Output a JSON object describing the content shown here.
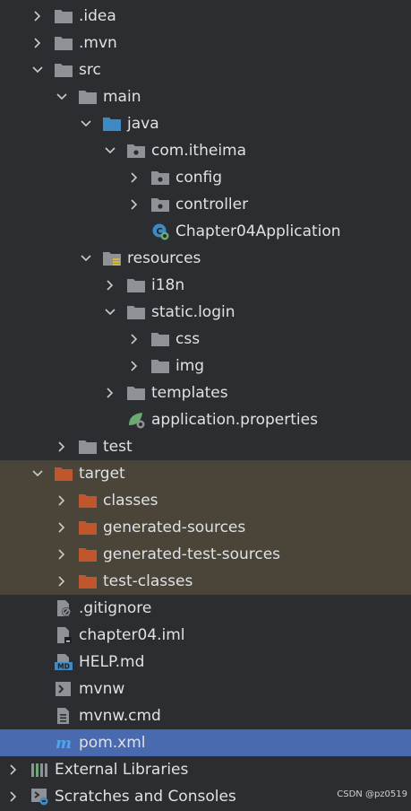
{
  "tree": [
    {
      "label": ".idea",
      "state": "collapsed",
      "icon": "folder-icon",
      "depth": 1
    },
    {
      "label": ".mvn",
      "state": "collapsed",
      "icon": "folder-icon",
      "depth": 1
    },
    {
      "label": "src",
      "state": "expanded",
      "icon": "folder-icon",
      "depth": 1
    },
    {
      "label": "main",
      "state": "expanded",
      "icon": "folder-icon",
      "depth": 2
    },
    {
      "label": "java",
      "state": "expanded",
      "icon": "source-folder-icon",
      "depth": 3
    },
    {
      "label": "com.itheima",
      "state": "expanded",
      "icon": "package-icon",
      "depth": 4
    },
    {
      "label": "config",
      "state": "collapsed",
      "icon": "package-icon",
      "depth": 5
    },
    {
      "label": "controller",
      "state": "collapsed",
      "icon": "package-icon",
      "depth": 5
    },
    {
      "label": "Chapter04Application",
      "state": "leaf",
      "icon": "spring-boot-class-icon",
      "depth": 5
    },
    {
      "label": "resources",
      "state": "expanded",
      "icon": "resources-folder-icon",
      "depth": 3
    },
    {
      "label": "i18n",
      "state": "collapsed",
      "icon": "folder-icon",
      "depth": 4
    },
    {
      "label": "static.login",
      "state": "expanded",
      "icon": "folder-icon",
      "depth": 4
    },
    {
      "label": "css",
      "state": "collapsed",
      "icon": "folder-icon",
      "depth": 5
    },
    {
      "label": "img",
      "state": "collapsed",
      "icon": "folder-icon",
      "depth": 5
    },
    {
      "label": "templates",
      "state": "collapsed",
      "icon": "folder-icon",
      "depth": 4
    },
    {
      "label": "application.properties",
      "state": "leaf",
      "icon": "spring-properties-icon",
      "depth": 4
    },
    {
      "label": "test",
      "state": "collapsed",
      "icon": "folder-icon",
      "depth": 2
    },
    {
      "label": "target",
      "state": "expanded",
      "icon": "excluded-folder-icon",
      "depth": 1,
      "highlight": "target"
    },
    {
      "label": "classes",
      "state": "collapsed",
      "icon": "excluded-folder-icon",
      "depth": 2,
      "highlight": "target"
    },
    {
      "label": "generated-sources",
      "state": "collapsed",
      "icon": "excluded-folder-icon",
      "depth": 2,
      "highlight": "target"
    },
    {
      "label": "generated-test-sources",
      "state": "collapsed",
      "icon": "excluded-folder-icon",
      "depth": 2,
      "highlight": "target"
    },
    {
      "label": "test-classes",
      "state": "collapsed",
      "icon": "excluded-folder-icon",
      "depth": 2,
      "highlight": "target"
    },
    {
      "label": ".gitignore",
      "state": "leaf",
      "icon": "gitignore-file-icon",
      "depth": 1
    },
    {
      "label": "chapter04.iml",
      "state": "leaf",
      "icon": "iml-file-icon",
      "depth": 1
    },
    {
      "label": "HELP.md",
      "state": "leaf",
      "icon": "markdown-file-icon",
      "depth": 1
    },
    {
      "label": "mvnw",
      "state": "leaf",
      "icon": "shell-script-icon",
      "depth": 1
    },
    {
      "label": "mvnw.cmd",
      "state": "leaf",
      "icon": "text-file-icon",
      "depth": 1
    },
    {
      "label": "pom.xml",
      "state": "leaf",
      "icon": "maven-pom-icon",
      "depth": 1,
      "selected": true
    },
    {
      "label": "External Libraries",
      "state": "collapsed",
      "icon": "libraries-icon",
      "depth": 0
    },
    {
      "label": "Scratches and Consoles",
      "state": "collapsed",
      "icon": "scratches-icon",
      "depth": 0
    }
  ],
  "watermark": "CSDN @pz0519",
  "colors": {
    "background": "#2b2d30",
    "text": "#dfe1e5",
    "folder": "#8e9297",
    "source_folder": "#3d8ac4",
    "excluded_folder": "#c0562b",
    "target_highlight": "#4a4538",
    "selection": "#4a6ab0"
  }
}
